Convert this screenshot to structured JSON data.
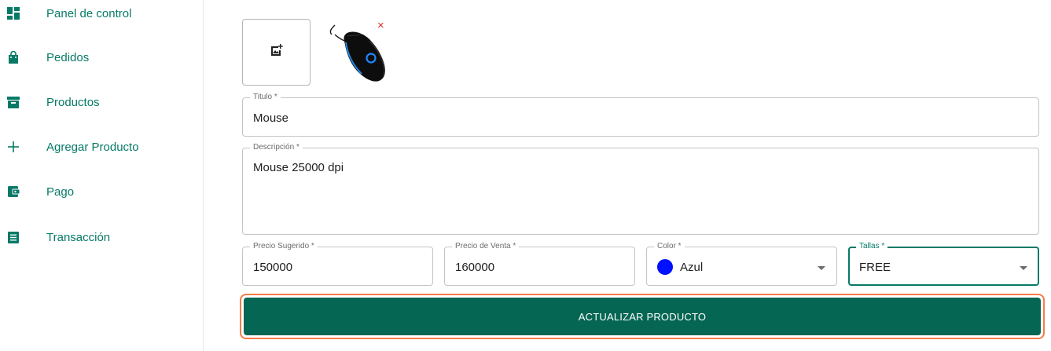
{
  "sidebar": {
    "items": [
      {
        "label": "Panel de control",
        "icon": "dashboard-icon"
      },
      {
        "label": "Pedidos",
        "icon": "shopping-bag-icon"
      },
      {
        "label": "Productos",
        "icon": "archive-box-icon"
      },
      {
        "label": "Agregar Producto",
        "icon": "plus-icon"
      },
      {
        "label": "Pago",
        "icon": "wallet-icon"
      },
      {
        "label": "Transacción",
        "icon": "receipt-list-icon"
      }
    ]
  },
  "images": {
    "add_icon": "add-photo-icon",
    "thumbnail_alt": "mouse-image",
    "remove_label": "×"
  },
  "form": {
    "title": {
      "label": "Titulo *",
      "value": "Mouse"
    },
    "description": {
      "label": "Descripción *",
      "value": "Mouse 25000 dpi"
    },
    "suggested_price": {
      "label": "Precio Sugerido *",
      "value": "150000"
    },
    "sale_price": {
      "label": "Precio de Venta *",
      "value": "160000"
    },
    "color": {
      "label": "Color *",
      "value": "Azul",
      "swatch": "#0011ff"
    },
    "sizes": {
      "label": "Tallas *",
      "value": "FREE"
    }
  },
  "submit": {
    "label": "ACTUALIZAR PRODUCTO"
  },
  "colors": {
    "accent": "#067a66",
    "button": "#046653",
    "highlight": "#f47c4a",
    "remove": "#d32f2f"
  }
}
